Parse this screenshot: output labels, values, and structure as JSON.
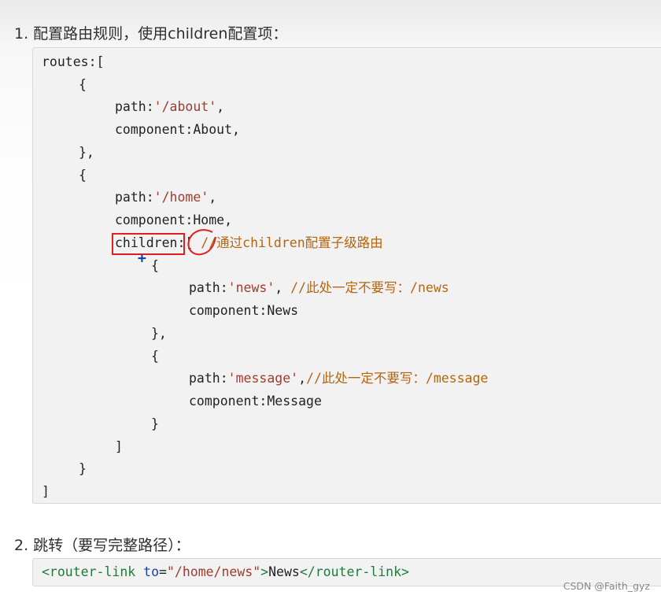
{
  "step1": {
    "heading": "1. 配置路由规则，使用children配置项："
  },
  "code1": {
    "l1": "routes:[",
    "l2": "{",
    "l3a": "path:",
    "l3b": "'/about'",
    "l3c": ",",
    "l4": "component:About,",
    "l5": "},",
    "l6": "{",
    "l7a": "path:",
    "l7b": "'/home'",
    "l7c": ",",
    "l8": "component:Home,",
    "l9a": "children",
    "l9b": ":[ ",
    "l9c": "//通过children配置子级路由",
    "l10": "{",
    "l11a": "path:",
    "l11b": "'news'",
    "l11c": ", ",
    "l11d": "//此处一定不要写：/news",
    "l12": "component:News",
    "l13": "},",
    "l14": "{",
    "l15a": "path:",
    "l15b": "'message'",
    "l15c": ",",
    "l15d": "//此处一定不要写：/message",
    "l16": "component:Message",
    "l17": "}",
    "l18": "]",
    "l19": "}",
    "l20": "]"
  },
  "step2": {
    "heading": "2. 跳转（要写完整路径）："
  },
  "code2": {
    "a": "<router-link ",
    "b": "to",
    "c": "=",
    "d": "\"/home/news\"",
    "e": ">",
    "f": "News",
    "g": "</router-link>"
  },
  "annotation": {
    "plus": "+",
    "box_color": "#e02020",
    "plus_color": "#1b3fa8"
  },
  "watermark": "CSDN @Faith_gyz"
}
